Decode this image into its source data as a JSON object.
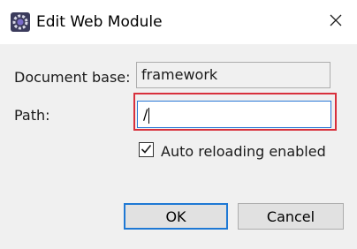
{
  "window": {
    "title": "Edit Web Module",
    "icon": "eclipse-gear-icon",
    "close_icon": "close-icon"
  },
  "form": {
    "document_base": {
      "label": "Document base:",
      "value": "framework"
    },
    "path": {
      "label": "Path:",
      "value": "/"
    },
    "auto_reload": {
      "label": "Auto reloading enabled",
      "checked": true
    }
  },
  "buttons": {
    "ok_label": "OK",
    "cancel_label": "Cancel"
  },
  "colors": {
    "highlight": "#d8303c",
    "focus_blue": "#1e78d4",
    "panel": "#f0f0f0"
  }
}
